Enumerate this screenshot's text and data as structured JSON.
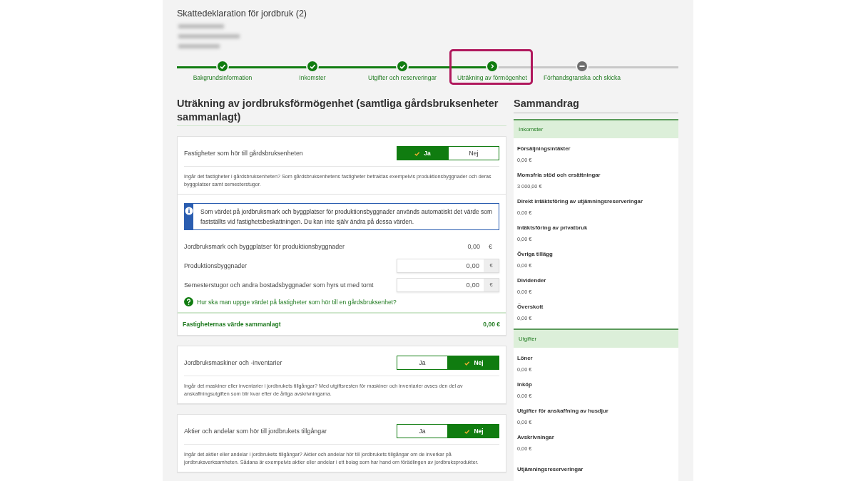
{
  "page_title": "Skattedeklaration för jordbruk (2)",
  "steps": [
    {
      "label": "Bakgrundsinformation",
      "completed": true,
      "current": false,
      "highlighted": false
    },
    {
      "label": "Inkomster",
      "completed": true,
      "current": false,
      "highlighted": false
    },
    {
      "label": "Utgifter och reserveringar",
      "completed": true,
      "current": false,
      "highlighted": false
    },
    {
      "label": "Uträkning av förmögenhet",
      "completed": false,
      "current": true,
      "highlighted": true
    },
    {
      "label": "Förhandsgranska och skicka",
      "completed": false,
      "current": false,
      "highlighted": false
    }
  ],
  "heading": "Uträkning av jordbruksförmögenhet (samtliga gårdsbruksenheter sammanlagt)",
  "questions": [
    {
      "question": "Fastigheter som hör till gårdsbruksenheten",
      "options": [
        {
          "label": "Ja",
          "selected": true
        },
        {
          "label": "Nej",
          "selected": false
        }
      ],
      "help": "Ingår det fastigheter i gårdsbruksenheten? Som gårdsbruksenhetens fastigheter betraktas exempelvis produktionsbyggnader och deras byggplatser samt semesterstugor.",
      "details": {
        "info": "Som värdet på jordbruksmark och byggplatser för produktionsbyggnader används automatiskt det värde som fastställts vid fastighetsbeskattningen. Du kan inte själv ändra på dessa värden.",
        "fields": [
          {
            "kind": "readonly",
            "label": "Jordbruksmark och byggplatser för produktionsbyggnader",
            "value": "0,00",
            "unit": "€"
          },
          {
            "kind": "input",
            "label": "Produktionsbyggnader",
            "value": "0,00",
            "unit": "€"
          },
          {
            "kind": "input",
            "label": "Semesterstugor och andra bostadsbyggnader som hyrs ut med tomt",
            "value": "0,00",
            "unit": "€"
          }
        ],
        "link": "Hur ska man uppge värdet på fastigheter som hör till en gårdsbruksenhet?",
        "total_label": "Fastigheternas värde sammanlagt",
        "total_value": "0,00 €"
      }
    },
    {
      "question": "Jordbruksmaskiner och -inventarier",
      "options": [
        {
          "label": "Ja",
          "selected": false
        },
        {
          "label": "Nej",
          "selected": true
        }
      ],
      "help": "Ingår det maskiner eller inventarier i jordbrukets tillgångar? Med utgiftsresten för maskiner och inventarier avses den del av anskaffningsutgiften som blir kvar efter de årliga avskrivningarna."
    },
    {
      "question": "Aktier och andelar som hör till jordbrukets tillgångar",
      "options": [
        {
          "label": "Ja",
          "selected": false
        },
        {
          "label": "Nej",
          "selected": true
        }
      ],
      "help": "Ingår det aktier eller andelar i jordbrukets tillgångar? Aktier och andelar hör till jordbrukets tillgångar om de inverkar på jordbruksverksamheten. Sådana är exempelvis aktier eller andelar i ett bolag som har hand om förädlingen av jordbruksprodukter."
    }
  ],
  "summary": {
    "title": "Sammandrag",
    "sections": [
      {
        "title": "Inkomster",
        "items": [
          {
            "label": "Försäljningsintäkter",
            "value": "0,00 €"
          },
          {
            "label": "Momsfria stöd och ersättningar",
            "value": "3 000,00 €"
          },
          {
            "label": "Direkt intäktsföring av utjämningsreserveringar",
            "value": "0,00 €"
          },
          {
            "label": "Intäktsföring av privatbruk",
            "value": "0,00 €"
          },
          {
            "label": "Övriga tillägg",
            "value": "0,00 €"
          },
          {
            "label": "Dividender",
            "value": "0,00 €"
          },
          {
            "label": "Överskott",
            "value": "0,00 €"
          }
        ]
      },
      {
        "title": "Utgifter",
        "items": [
          {
            "label": "Löner",
            "value": "0,00 €"
          },
          {
            "label": "Inköp",
            "value": "0,00 €"
          },
          {
            "label": "Utgifter för anskaffning av husdjur",
            "value": "0,00 €"
          },
          {
            "label": "Avskrivningar",
            "value": "0,00 €"
          },
          {
            "label": "Utjämningsreserveringar"
          }
        ]
      }
    ]
  }
}
